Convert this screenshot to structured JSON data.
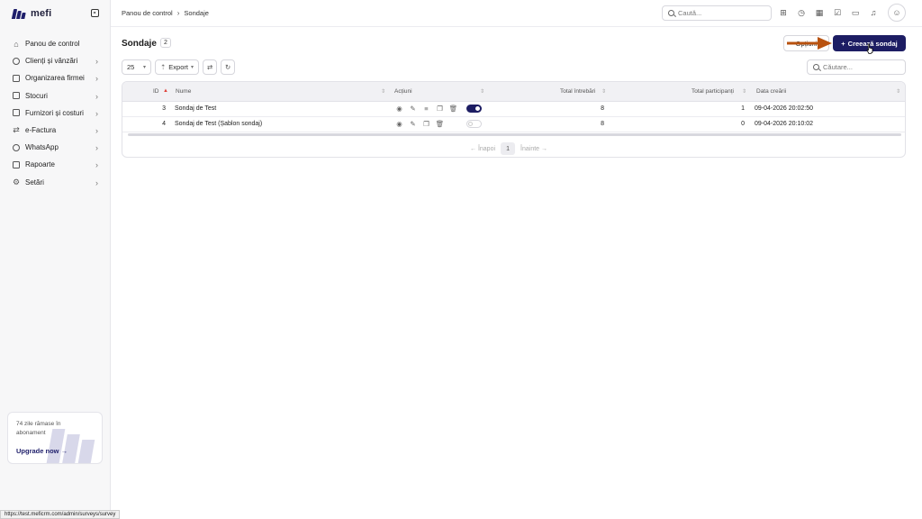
{
  "app": {
    "brand": "mefi"
  },
  "sidebar": {
    "items": [
      {
        "label": "Panou de control",
        "icon": "home-icon",
        "has_children": false
      },
      {
        "label": "Clienți și vânzări",
        "icon": "users-icon",
        "has_children": true
      },
      {
        "label": "Organizarea firmei",
        "icon": "building-icon",
        "has_children": true
      },
      {
        "label": "Stocuri",
        "icon": "box-icon",
        "has_children": true
      },
      {
        "label": "Furnizori și costuri",
        "icon": "wallet-icon",
        "has_children": true
      },
      {
        "label": "e-Factura",
        "icon": "invoice-icon",
        "has_children": true
      },
      {
        "label": "WhatsApp",
        "icon": "whatsapp-icon",
        "has_children": true
      },
      {
        "label": "Rapoarte",
        "icon": "clipboard-icon",
        "has_children": true
      },
      {
        "label": "Setări",
        "icon": "gear-icon",
        "has_children": true
      }
    ],
    "upgrade": {
      "days_text": "74 zile rămase în abonament",
      "link_label": "Upgrade now"
    }
  },
  "topbar": {
    "breadcrumb": [
      "Panou de control",
      "Sondaje"
    ],
    "search_placeholder": "Caută...",
    "icons": [
      "add-square-icon",
      "timer-icon",
      "calendar-icon",
      "check-square-icon",
      "chat-icon",
      "bell-icon"
    ]
  },
  "page": {
    "title": "Sondaje",
    "count": "2",
    "options_label": "Opțiuni",
    "create_label": "Creează sondaj",
    "page_size": "25",
    "export_label": "Export",
    "table_search_placeholder": "Căutare..."
  },
  "table": {
    "columns": {
      "id": "ID",
      "name": "Nume",
      "actions": "Acțiuni",
      "total_questions": "Total întrebări",
      "total_participants": "Total participanți",
      "created": "Data creării"
    },
    "rows": [
      {
        "id": "3",
        "name": "Sondaj de Test",
        "total_questions": "8",
        "total_participants": "1",
        "created": "09-04-2026 20:02:50",
        "active": true
      },
      {
        "id": "4",
        "name": "Sondaj de Test (Șablon sondaj)",
        "total_questions": "8",
        "total_participants": "0",
        "created": "09-04-2026 20:10:02",
        "active": false
      }
    ],
    "pagination": {
      "prev": "Înapoi",
      "current": "1",
      "next": "Înainte"
    }
  },
  "status_bar": {
    "url": "https://test.meficrm.com/admin/surveys/survey"
  },
  "colors": {
    "primary": "#1d1d63",
    "annotation_arrow": "#b8520f",
    "sort_active": "#e0443c"
  }
}
